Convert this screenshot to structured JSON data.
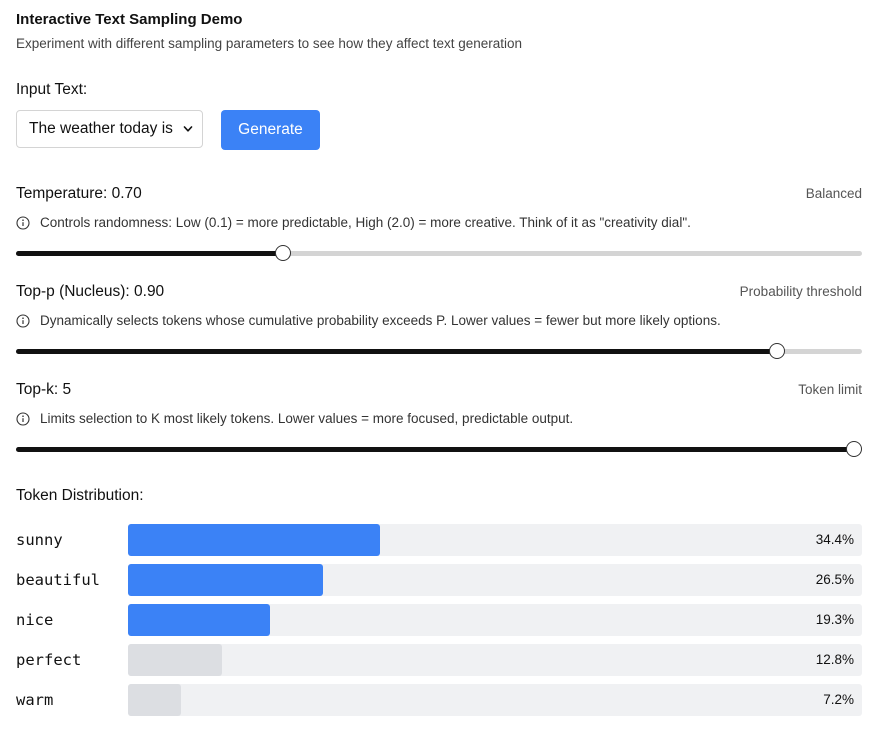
{
  "header": {
    "title": "Interactive Text Sampling Demo",
    "subtitle": "Experiment with different sampling parameters to see how they affect text generation"
  },
  "input": {
    "label": "Input Text:",
    "selected": "The weather today is",
    "generate_label": "Generate"
  },
  "params": {
    "temperature": {
      "label": "Temperature: 0.70",
      "tag": "Balanced",
      "description": "Controls randomness: Low (0.1) = more predictable, High (2.0) = more creative. Think of it as \"creativity dial\".",
      "value": 0.7,
      "min": 0.1,
      "max": 2.0
    },
    "top_p": {
      "label": "Top-p (Nucleus): 0.90",
      "tag": "Probability threshold",
      "description": "Dynamically selects tokens whose cumulative probability exceeds P. Lower values = fewer but more likely options.",
      "value": 0.9,
      "min": 0.0,
      "max": 1.0
    },
    "top_k": {
      "label": "Top-k: 5",
      "tag": "Token limit",
      "description": "Limits selection to K most likely tokens. Lower values = more focused, predictable output.",
      "value": 5,
      "min": 1,
      "max": 5
    }
  },
  "distribution": {
    "label": "Token Distribution:",
    "active_color": "#3b82f6",
    "inactive_color": "#dcdee2",
    "tokens": [
      {
        "token": "sunny",
        "percent": "34.4%",
        "value": 34.4,
        "selected": true
      },
      {
        "token": "beautiful",
        "percent": "26.5%",
        "value": 26.5,
        "selected": true
      },
      {
        "token": "nice",
        "percent": "19.3%",
        "value": 19.3,
        "selected": true
      },
      {
        "token": "perfect",
        "percent": "12.8%",
        "value": 12.8,
        "selected": false
      },
      {
        "token": "warm",
        "percent": "7.2%",
        "value": 7.2,
        "selected": false
      }
    ]
  }
}
